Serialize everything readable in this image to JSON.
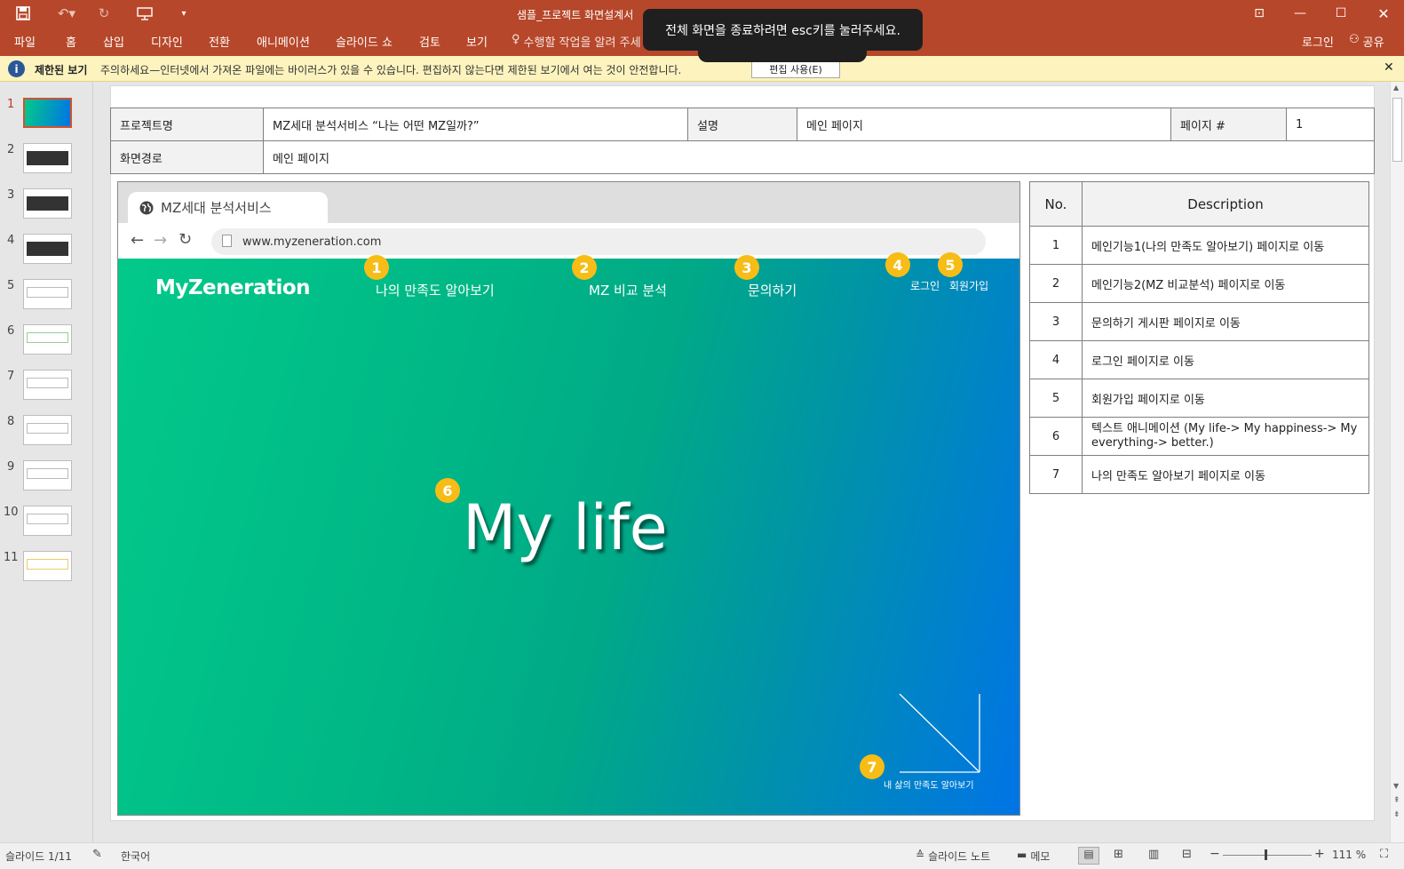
{
  "titlebar": {
    "doc_title": "샘플_프로젝트 화면설계서"
  },
  "ribbon": {
    "tabs": [
      "파일",
      "홈",
      "삽입",
      "디자인",
      "전환",
      "애니메이션",
      "슬라이드 쇼",
      "검토",
      "보기"
    ],
    "tell_me": "수행할 작업을 알려 주세",
    "login": "로그인",
    "share": "공유"
  },
  "toast": {
    "message": "전체 화면을 종료하려면 esc키를 눌러주세요."
  },
  "infobar": {
    "title": "제한된 보기",
    "message": "주의하세요—인터넷에서 가져온 파일에는 바이러스가 있을 수 있습니다. 편집하지 않는다면 제한된 보기에서 여는 것이 안전합니다.",
    "enable_button": "편집 사용(E)"
  },
  "thumbnails": [
    "1",
    "2",
    "3",
    "4",
    "5",
    "6",
    "7",
    "8",
    "9",
    "10",
    "11"
  ],
  "header_table": {
    "project_label": "프로젝트명",
    "project_value": "MZ세대 분석서비스 “나는 어떤 MZ일까?”",
    "desc_label": "설명",
    "desc_value": "메인 페이지",
    "page_label": "페이지 #",
    "page_value": "1",
    "path_label": "화면경로",
    "path_value": "메인 페이지"
  },
  "browser": {
    "tab_title": "MZ세대 분석서비스",
    "url": "www.myzeneration.com"
  },
  "site": {
    "logo": "MyZeneration",
    "nav": [
      "나의 만족도 알아보기",
      "MZ 비교 분석",
      "문의하기"
    ],
    "login": "로그인",
    "signup": "회원가입",
    "hero_text": "My life",
    "cta": "내 삶의 만족도 알아보기",
    "badges": [
      "1",
      "2",
      "3",
      "4",
      "5",
      "6",
      "7"
    ]
  },
  "desc_table": {
    "col_no": "No.",
    "col_desc": "Description",
    "rows": [
      {
        "no": "1",
        "desc": "메인기능1(나의 만족도 알아보기) 페이지로 이동"
      },
      {
        "no": "2",
        "desc": "메인기능2(MZ 비교분석) 페이지로 이동"
      },
      {
        "no": "3",
        "desc": "문의하기 게시판 페이지로 이동"
      },
      {
        "no": "4",
        "desc": "로그인 페이지로 이동"
      },
      {
        "no": "5",
        "desc": "회원가입 페이지로 이동"
      },
      {
        "no": "6",
        "desc": "텍스트 애니메이션 (My life-> My happiness-> My everything-> better.)"
      },
      {
        "no": "7",
        "desc": "나의 만족도 알아보기 페이지로 이동"
      }
    ]
  },
  "status": {
    "slide_info": "슬라이드 1/11",
    "language": "한국어",
    "notes": "슬라이드 노트",
    "comments": "메모",
    "zoom": "111 %"
  },
  "colors": {
    "ribbon": "#b7472a",
    "infobar": "#fcf3be",
    "badge": "#f7bd16",
    "hero_start": "#02c98a",
    "hero_end": "#0074e6"
  }
}
